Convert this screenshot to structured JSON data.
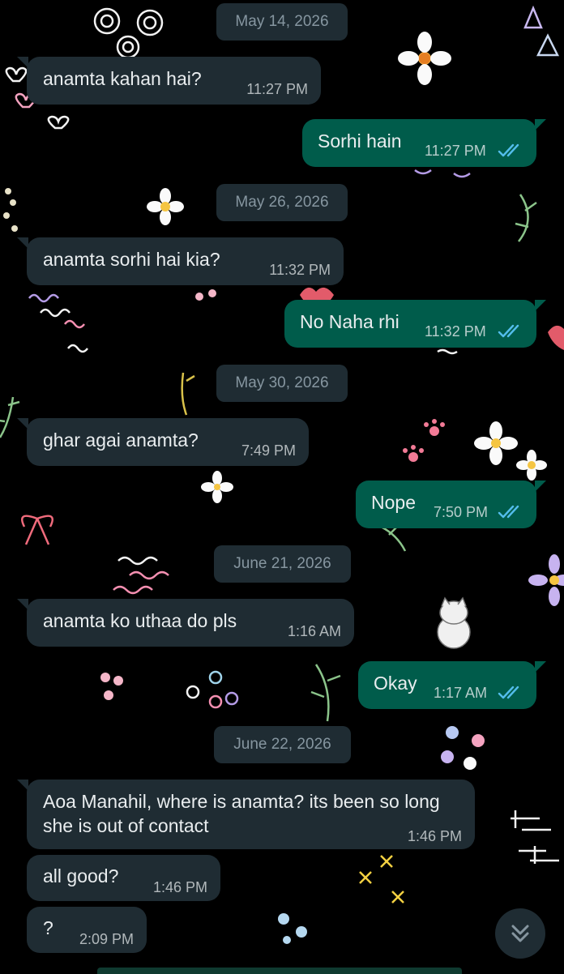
{
  "colors": {
    "background": "#000000",
    "incoming_bubble": "#1f2c33",
    "outgoing_bubble": "#005c4b",
    "read_ticks": "#53bdeb",
    "date_chip": "#1f2c33"
  },
  "dates": [
    "May 14, 2026",
    "May 26, 2026",
    "May 30, 2026",
    "June 21, 2026",
    "June 22, 2026"
  ],
  "messages": [
    {
      "direction": "incoming",
      "text": "anamta kahan hai?",
      "time": "11:27 PM"
    },
    {
      "direction": "outgoing",
      "text": "Sorhi hain",
      "time": "11:27 PM",
      "status": "read-ticks-icon"
    },
    {
      "direction": "incoming",
      "text": "anamta sorhi hai kia?",
      "time": "11:32 PM"
    },
    {
      "direction": "outgoing",
      "text": "No Naha rhi",
      "time": "11:32 PM",
      "status": "read-ticks-icon"
    },
    {
      "direction": "incoming",
      "text": "ghar agai anamta?",
      "time": "7:49 PM"
    },
    {
      "direction": "outgoing",
      "text": "Nope",
      "time": "7:50 PM",
      "status": "read-ticks-icon"
    },
    {
      "direction": "incoming",
      "text": "anamta ko uthaa do pls",
      "time": "1:16 AM"
    },
    {
      "direction": "outgoing",
      "text": "Okay",
      "time": "1:17 AM",
      "status": "read-ticks-icon"
    },
    {
      "direction": "incoming",
      "text": "Aoa Manahil, where is anamta? its been so long she is out of contact",
      "time": "1:46 PM"
    },
    {
      "direction": "incoming",
      "text": "all good?",
      "time": "1:46 PM"
    },
    {
      "direction": "incoming",
      "text": "?",
      "time": "2:09 PM"
    }
  ],
  "scroll_button": {
    "icon": "double-chevron-down-icon"
  }
}
